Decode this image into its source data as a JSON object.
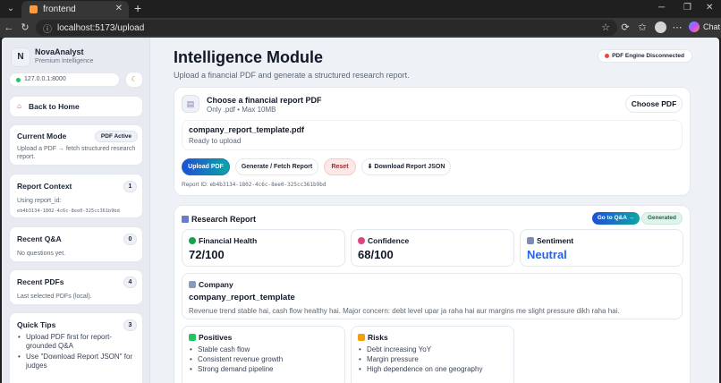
{
  "browser": {
    "tab_title": "frontend",
    "url": "localhost:5173/upload",
    "chat_label": "Chat",
    "colors": {
      "favicon": "#ff9a3c"
    }
  },
  "sidebar": {
    "brand": {
      "logo_letter": "N",
      "name": "NovaAnalyst",
      "subtitle": "Premium Intelligence"
    },
    "server": "127.0.0.1:8000",
    "back_label": "Back to Home",
    "current_mode": {
      "title": "Current Mode",
      "badge": "PDF Active",
      "text_1": "Upload a PDF → fetch structured research",
      "text_2": "report."
    },
    "report_context": {
      "title": "Report Context",
      "count": "1",
      "text": "Using report_id:",
      "id": "eb4b3134-1802-4c6c-8ee0-325cc361b9bd"
    },
    "recent_qa": {
      "title": "Recent Q&A",
      "count": "0",
      "text": "No questions yet."
    },
    "recent_pdfs": {
      "title": "Recent PDFs",
      "count": "4",
      "text": "Last selected PDFs (local)."
    },
    "quick_tips": {
      "title": "Quick Tips",
      "count": "3",
      "items": [
        "Upload PDF first for report-grounded Q&A",
        "Use \"Download Report JSON\" for judges"
      ]
    }
  },
  "main": {
    "title": "Intelligence Module",
    "subtitle": "Upload a financial PDF and generate a structured research report.",
    "engine_status": "PDF Engine Disconnected",
    "upload": {
      "title": "Choose a financial report PDF",
      "subtitle": "Only .pdf • Max 10MB",
      "choose_label": "Choose PDF",
      "file_name": "company_report_template.pdf",
      "file_status": "Ready to upload",
      "buttons": {
        "upload": "Upload PDF",
        "generate": "Generate / Fetch Report",
        "reset": "Reset",
        "download": "⬇ Download Report JSON"
      },
      "report_id_label": "Report ID:",
      "report_id": "eb4b3134-1802-4c6c-8ee0-325cc361b9bd"
    },
    "report": {
      "title": "Research Report",
      "qa_label": "Go to Q&A →",
      "status": "Generated",
      "metrics": [
        {
          "label": "Financial Health",
          "value": "72/100",
          "icon": "heart-icon"
        },
        {
          "label": "Confidence",
          "value": "68/100",
          "icon": "target-icon"
        },
        {
          "label": "Sentiment",
          "value": "Neutral",
          "icon": "chart-icon"
        }
      ],
      "company": {
        "label": "Company",
        "name": "company_report_template",
        "summary": "Revenue trend stable hai, cash flow healthy hai. Major concern: debt level upar ja raha hai aur margins me slight pressure dikh raha hai."
      },
      "positives": {
        "title": "Positives",
        "items": [
          "Stable cash flow",
          "Consistent revenue growth",
          "Strong demand pipeline"
        ]
      },
      "risks": {
        "title": "Risks",
        "items": [
          "Debt increasing YoY",
          "Margin pressure",
          "High dependence on one geography"
        ]
      }
    }
  },
  "colors": {
    "accent_start": "#1d4ed8",
    "accent_end": "#0ea5a4",
    "sentiment": "#2563eb",
    "status_ok": "#22c55e",
    "status_error": "#ef4444"
  }
}
